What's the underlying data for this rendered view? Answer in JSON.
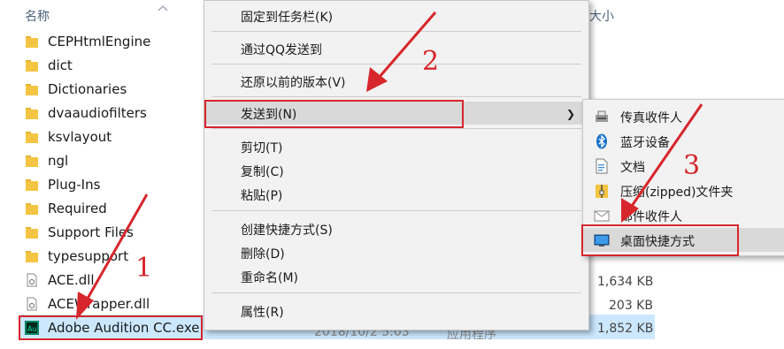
{
  "header": {
    "name_col": "名称",
    "size_col": "大小"
  },
  "files": [
    {
      "name": "CEPHtmlEngine",
      "type": "folder"
    },
    {
      "name": "dict",
      "type": "folder"
    },
    {
      "name": "Dictionaries",
      "type": "folder"
    },
    {
      "name": "dvaaudiofilters",
      "type": "folder"
    },
    {
      "name": "ksvlayout",
      "type": "folder"
    },
    {
      "name": "ngl",
      "type": "folder"
    },
    {
      "name": "Plug-Ins",
      "type": "folder"
    },
    {
      "name": "Required",
      "type": "folder"
    },
    {
      "name": "Support Files",
      "type": "folder"
    },
    {
      "name": "typesupport",
      "type": "folder"
    },
    {
      "name": "ACE.dll",
      "type": "dll",
      "size": "1,634 KB"
    },
    {
      "name": "ACEWrapper.dll",
      "type": "dll",
      "size": "203 KB"
    },
    {
      "name": "Adobe Audition CC.exe",
      "type": "exe",
      "date": "2018/10/2 5:03",
      "kind": "应用程序",
      "size": "1,852 KB"
    }
  ],
  "context_menu": {
    "items": [
      {
        "label": "固定到任务栏(K)"
      },
      {
        "label": "通过QQ发送到"
      },
      {
        "label": "还原以前的版本(V)"
      },
      {
        "label": "发送到(N)"
      },
      {
        "label": "剪切(T)"
      },
      {
        "label": "复制(C)"
      },
      {
        "label": "粘贴(P)"
      },
      {
        "label": "创建快捷方式(S)"
      },
      {
        "label": "删除(D)"
      },
      {
        "label": "重命名(M)"
      },
      {
        "label": "属性(R)"
      }
    ]
  },
  "send_to_menu": {
    "items": [
      {
        "label": "传真收件人",
        "icon": "fax-icon"
      },
      {
        "label": "蓝牙设备",
        "icon": "bluetooth-icon"
      },
      {
        "label": "文档",
        "icon": "document-icon"
      },
      {
        "label": "压缩(zipped)文件夹",
        "icon": "zip-folder-icon"
      },
      {
        "label": "邮件收件人",
        "icon": "mail-icon"
      },
      {
        "label": "桌面快捷方式",
        "icon": "desktop-icon"
      }
    ]
  },
  "annotations": {
    "step1": "1",
    "step2": "2",
    "step3": "3"
  },
  "colors": {
    "annotation_red": "#d7262c",
    "selection_blue": "#cce8ff",
    "menu_bg": "#f2f2f2",
    "menu_highlight": "#d9d9d9",
    "folder_yellow": "#f4c542"
  }
}
